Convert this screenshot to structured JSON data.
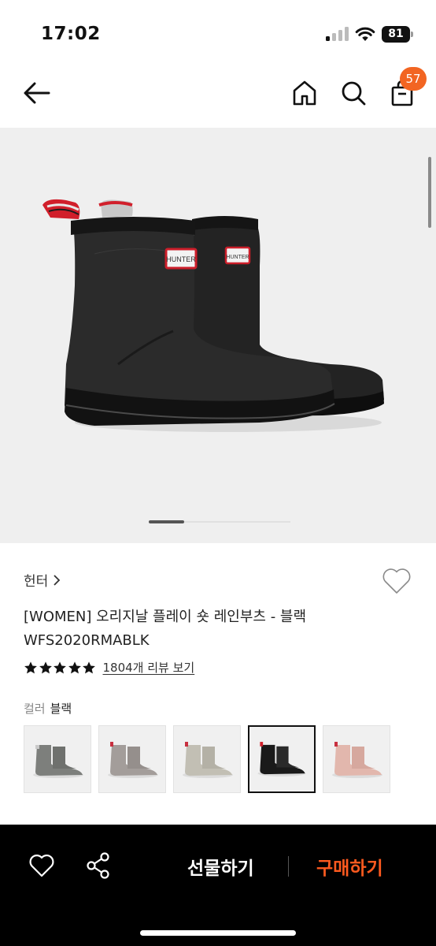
{
  "status_bar": {
    "time": "17:02",
    "battery": "81"
  },
  "nav": {
    "back_icon": "arrow-left-icon",
    "home_icon": "home-icon",
    "search_icon": "search-icon",
    "cart_icon": "shopping-bag-icon",
    "cart_count": "57",
    "badge_color": "#f26522"
  },
  "hero": {
    "image": "black-hunter-rain-boots",
    "brand_tag": "HUNTER",
    "carousel_position": 1
  },
  "product": {
    "brand": "헌터",
    "title": "[WOMEN] 오리지날 플레이 숏 레인부츠 - 블랙",
    "code": "WFS2020RMABLK",
    "rating_stars": 5,
    "review_link": "1804개 리뷰 보기",
    "wish_icon": "heart-outline-icon"
  },
  "color": {
    "label": "컬러",
    "value": "블랙",
    "options": [
      {
        "name": "gray",
        "hex": "#7d7f7c"
      },
      {
        "name": "taupe",
        "hex": "#a39d9a"
      },
      {
        "name": "beige",
        "hex": "#c2bfb4"
      },
      {
        "name": "black",
        "hex": "#1a1a1a",
        "selected": true
      },
      {
        "name": "pink",
        "hex": "#e2b7ad"
      }
    ]
  },
  "bottom_bar": {
    "wish_icon": "heart-outline-icon",
    "share_icon": "share-icon",
    "gift_label": "선물하기",
    "buy_label": "구매하기",
    "buy_color": "#ff5a1f"
  }
}
